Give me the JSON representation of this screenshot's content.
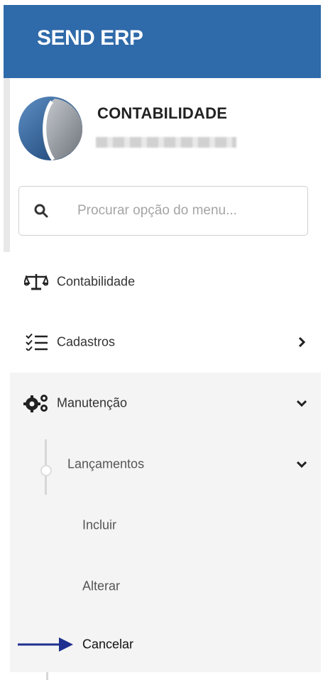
{
  "header": {
    "brand": "SEND ERP"
  },
  "profile": {
    "name": "CONTABILIDADE",
    "logo_icon": "company-logo-icon"
  },
  "search": {
    "placeholder": "Procurar opção do menu...",
    "icon": "search-icon"
  },
  "menu": [
    {
      "label": "Contabilidade",
      "icon": "balance-scale-icon"
    },
    {
      "label": "Cadastros",
      "icon": "list-check-icon",
      "expander": "chevron-right-icon"
    },
    {
      "label": "Manutenção",
      "icon": "gears-icon",
      "expander": "chevron-down-icon",
      "expanded": true,
      "children": [
        {
          "label": "Lançamentos",
          "expander": "chevron-down-icon",
          "expanded": true,
          "children": [
            {
              "label": "Incluir"
            },
            {
              "label": "Alterar"
            },
            {
              "label": "Cancelar",
              "highlighted": true
            }
          ]
        }
      ]
    }
  ],
  "annotation": {
    "icon": "pointer-arrow-icon"
  },
  "colors": {
    "header_bg": "#2f6aaa",
    "arrow": "#1f2f8f",
    "selected_bg": "#f4f4f4"
  }
}
